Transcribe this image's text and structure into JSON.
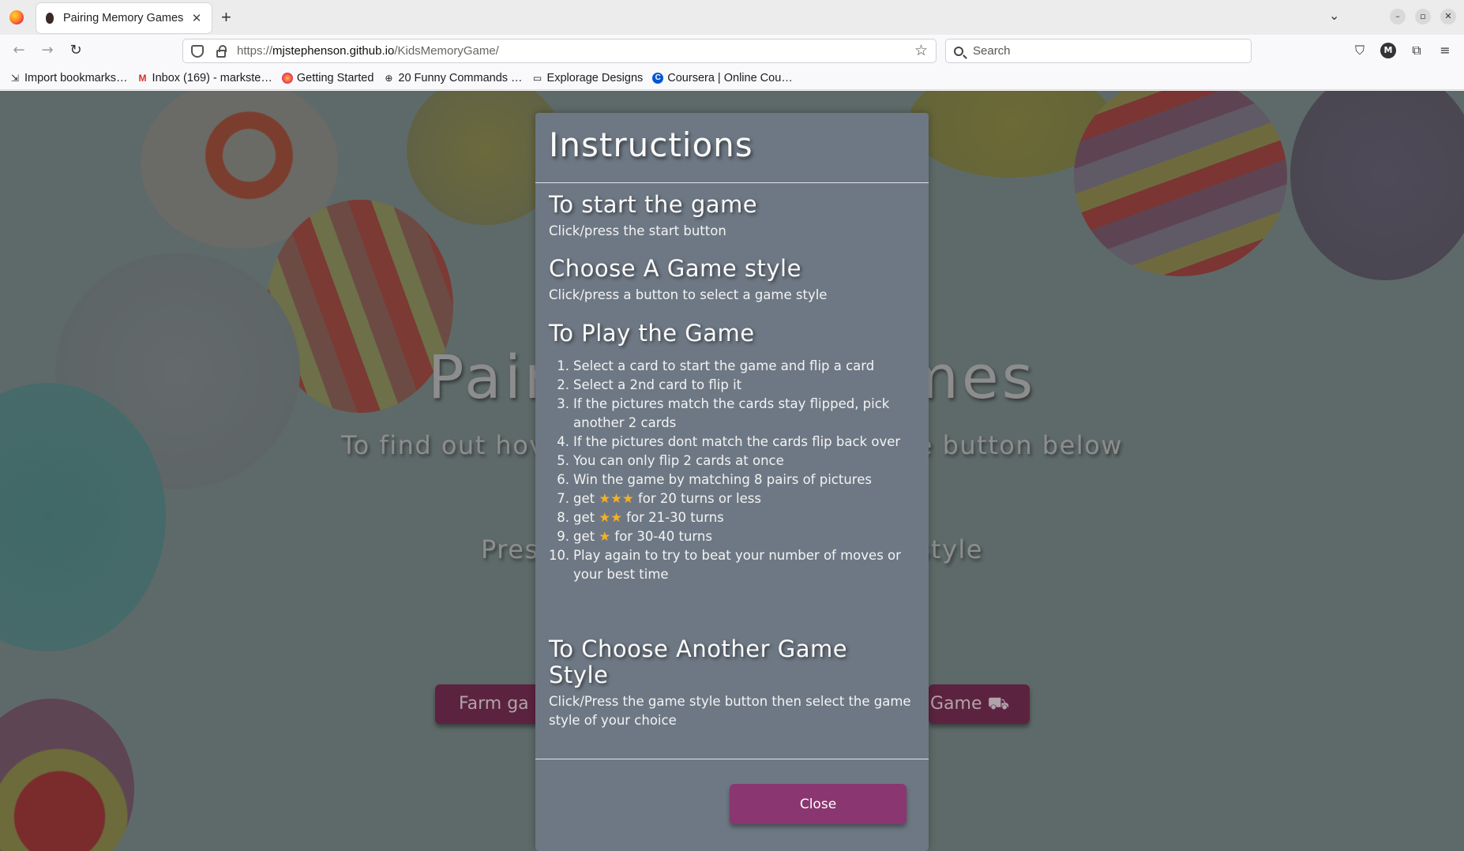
{
  "browser": {
    "tab_title": "Pairing Memory Games",
    "new_tab": "+",
    "tab_close": "✕",
    "url_prefix": "https://",
    "url_host": "mjstephenson.github.io",
    "url_path": "/KidsMemoryGame/",
    "search_placeholder": "Search",
    "avatar_letter": "M",
    "bookmarks": [
      {
        "label": "Import bookmarks…",
        "icon": "import-icon"
      },
      {
        "label": "Inbox (169) - markste…",
        "icon": "gmail-icon"
      },
      {
        "label": "Getting Started",
        "icon": "firefox-icon"
      },
      {
        "label": "20 Funny Commands …",
        "icon": "globe-icon"
      },
      {
        "label": "Explorage Designs",
        "icon": "folder-icon"
      },
      {
        "label": "Coursera | Online Cou…",
        "icon": "coursera-icon"
      }
    ]
  },
  "background": {
    "title_left": "Pairin",
    "title_right": "Games",
    "subtitle_left": "To find out hov",
    "subtitle_right": "e button below",
    "press_left": "Press",
    "press_right": "style",
    "btn_left": "Farm ga",
    "btn_right": "Game"
  },
  "modal": {
    "title": "Instructions",
    "sections": {
      "start_heading": "To start the game",
      "start_text": "Click/press the start button",
      "style_heading": "Choose A Game style",
      "style_text": "Click/press a button to select a game style",
      "play_heading": "To Play the Game",
      "another_heading": "To Choose Another Game Style",
      "another_text": "Click/Press the game style button then select the game style of your choice"
    },
    "steps": [
      {
        "num": "1.",
        "text": "Select a card to start the game and flip a card"
      },
      {
        "num": "2.",
        "text": "Select a 2nd card to flip it"
      },
      {
        "num": "3.",
        "text": "If the pictures match the cards stay flipped, pick another 2 cards"
      },
      {
        "num": "4.",
        "text": "If the pictures dont match the cards flip back over"
      },
      {
        "num": "5.",
        "text": "You can only flip 2 cards at once"
      },
      {
        "num": "6.",
        "text": "Win the game by matching 8 pairs of pictures"
      },
      {
        "num": "7.",
        "pre": "get ",
        "stars": "★★★",
        "post": " for 20 turns or less"
      },
      {
        "num": "8.",
        "pre": "get ",
        "stars": "★★",
        "post": " for 21-30 turns"
      },
      {
        "num": "9.",
        "pre": "get ",
        "stars": "★",
        "post": " for 30-40 turns"
      },
      {
        "num": "10.",
        "text": "Play again to try to beat your number of moves or your best time"
      }
    ],
    "close_label": "Close"
  },
  "colors": {
    "modal_bg": "#6e7884",
    "close_button": "#8a3670",
    "star": "#f5b027",
    "overlay_buttons": "#5c2340"
  }
}
